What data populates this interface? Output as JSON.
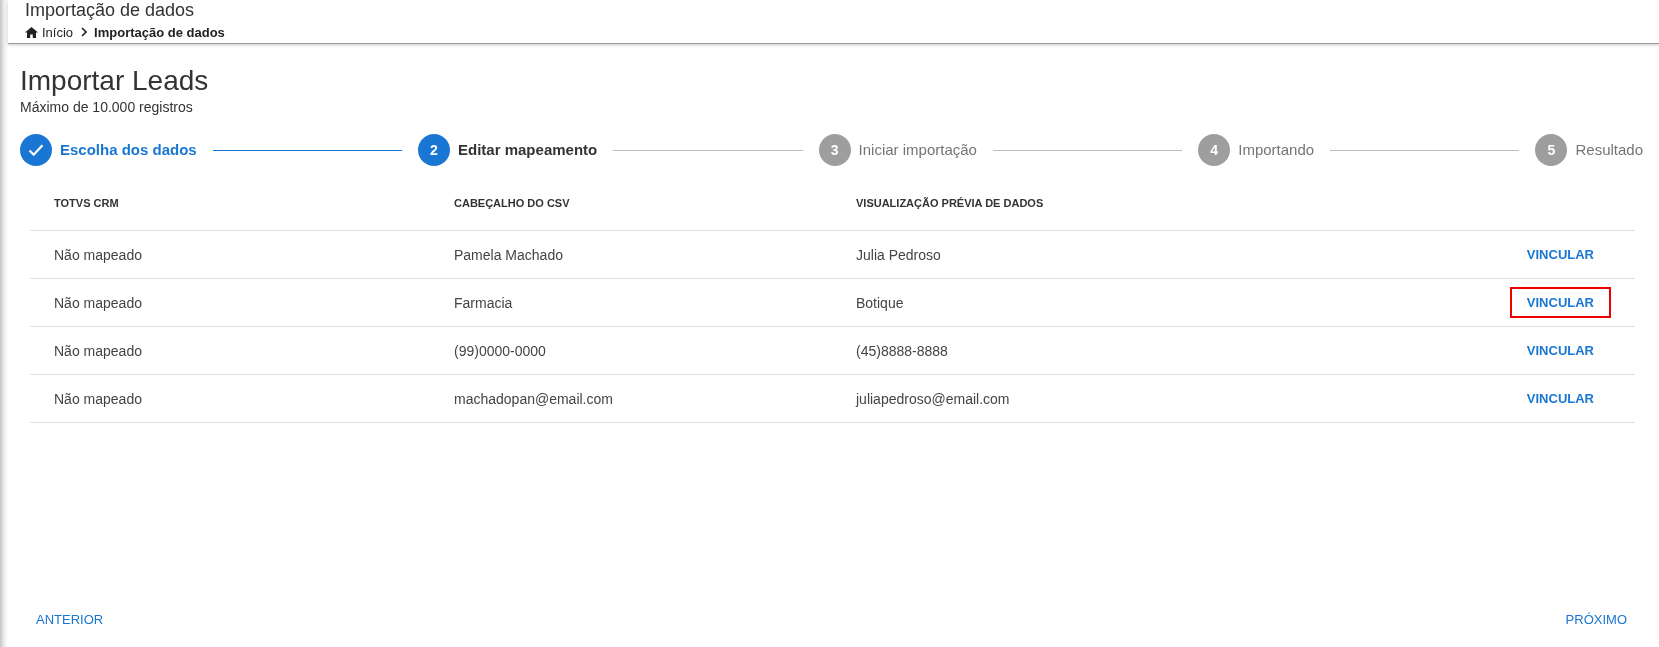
{
  "header": {
    "title": "Importação de dados",
    "breadcrumb": [
      {
        "label": "Início",
        "kind": "home"
      },
      {
        "label": "Importação de dados",
        "kind": "current"
      }
    ]
  },
  "page": {
    "title": "Importar Leads",
    "subtitle": "Máximo de 10.000 registros"
  },
  "steps": [
    {
      "label": "Escolha dos dados",
      "completed": true,
      "selected": false
    },
    {
      "number": "2",
      "label": "Editar mapeamento",
      "completed": false,
      "selected": true
    },
    {
      "number": "3",
      "label": "Iniciar importação",
      "completed": false,
      "selected": false
    },
    {
      "number": "4",
      "label": "Importando",
      "completed": false,
      "selected": false
    },
    {
      "number": "5",
      "label": "Resultado",
      "completed": false,
      "selected": false
    }
  ],
  "table": {
    "columns": [
      "TOTVS CRM",
      "CABEÇALHO DO CSV",
      "VISUALIZAÇÃO PRÉVIA DE DADOS"
    ],
    "rows": [
      {
        "cells": [
          "Não mapeado",
          "Pamela Machado",
          "Julia Pedroso"
        ],
        "action": {
          "label": "VINCULAR",
          "highlighted": false
        }
      },
      {
        "cells": [
          "Não mapeado",
          "Farmacia",
          "Botique"
        ],
        "action": {
          "label": "VINCULAR",
          "highlighted": true
        }
      },
      {
        "cells": [
          "Não mapeado",
          "(99)0000-0000",
          "(45)8888-8888"
        ],
        "action": {
          "label": "VINCULAR",
          "highlighted": false
        }
      },
      {
        "cells": [
          "Não mapeado",
          "machadopan@email.com",
          "juliapedroso@email.com"
        ],
        "action": {
          "label": "VINCULAR",
          "highlighted": false
        }
      }
    ]
  },
  "footer": {
    "previous": "ANTERIOR",
    "next": "PRÓXIMO"
  }
}
